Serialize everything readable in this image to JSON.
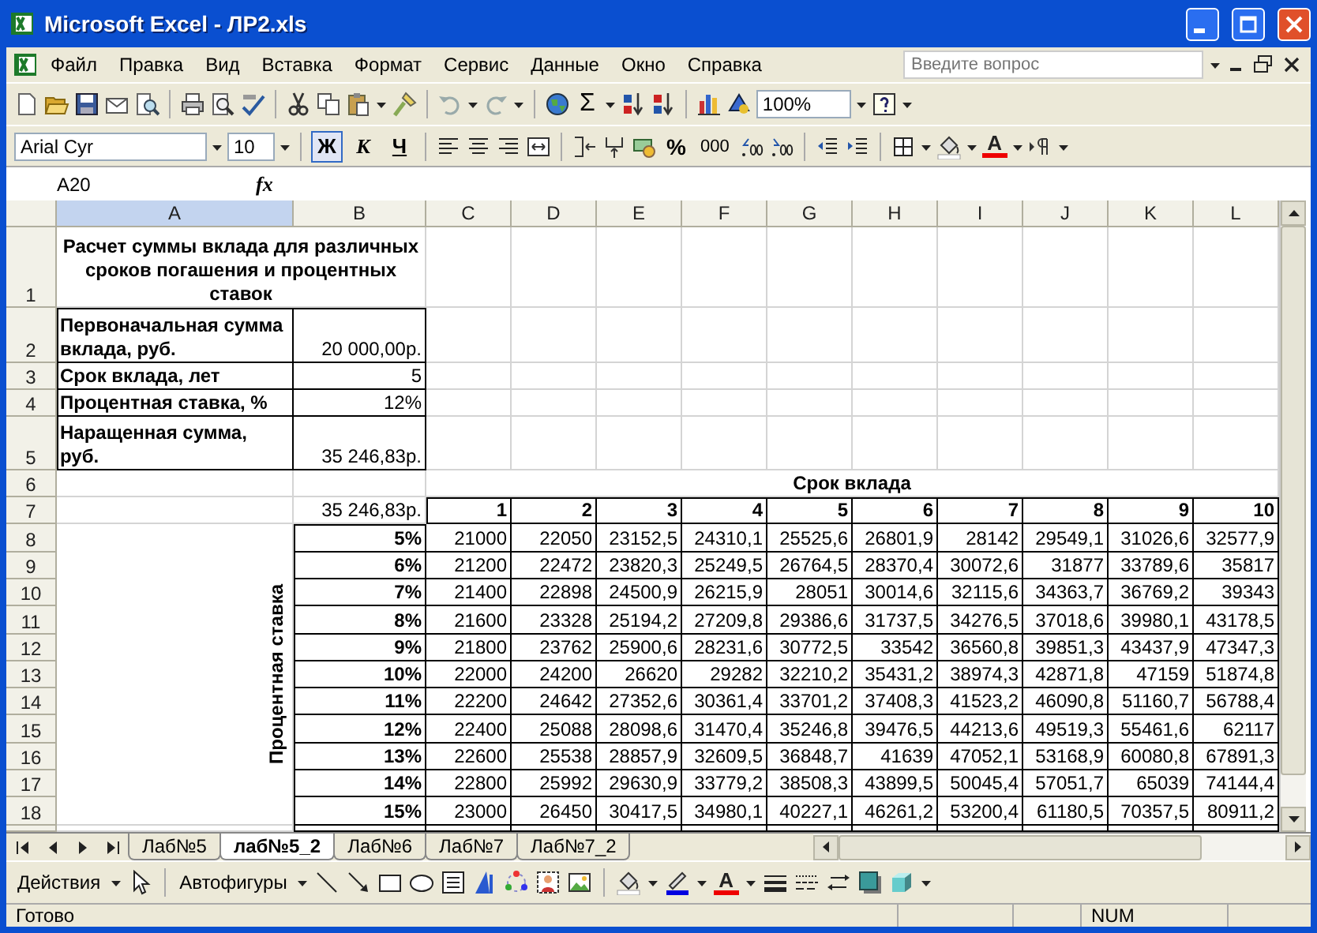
{
  "window": {
    "title": "Microsoft Excel - ЛР2.xls"
  },
  "menu": [
    "Файл",
    "Правка",
    "Вид",
    "Вставка",
    "Формат",
    "Сервис",
    "Данные",
    "Окно",
    "Справка"
  ],
  "help_search": {
    "placeholder": "Введите вопрос"
  },
  "standard_toolbar": {
    "sum": "Σ",
    "zoom": "100%"
  },
  "formatting_toolbar": {
    "font": "Arial Cyr",
    "size": "10",
    "bold": {
      "label": "Ж",
      "pressed": true
    },
    "italic": {
      "label": "К",
      "pressed": false
    },
    "underline": {
      "label": "Ч",
      "pressed": false
    },
    "percent": "%",
    "thousands": "000",
    "font_color": "A"
  },
  "formula_bar": {
    "name_box": "A20",
    "function_label": "fx"
  },
  "sheet": {
    "columns": [
      {
        "label": "A",
        "selected": true
      },
      {
        "label": "B",
        "selected": false
      },
      {
        "label": "C",
        "selected": false
      },
      {
        "label": "D",
        "selected": false
      },
      {
        "label": "E",
        "selected": false
      },
      {
        "label": "F",
        "selected": false
      },
      {
        "label": "G",
        "selected": false
      },
      {
        "label": "H",
        "selected": false
      },
      {
        "label": "I",
        "selected": false
      },
      {
        "label": "J",
        "selected": false
      },
      {
        "label": "K",
        "selected": false
      },
      {
        "label": "L",
        "selected": false
      }
    ],
    "rows": [
      "1",
      "2",
      "3",
      "4",
      "5",
      "6",
      "7",
      "8",
      "9",
      "10",
      "11",
      "12",
      "13",
      "14",
      "15",
      "16",
      "17",
      "18"
    ],
    "title": "Расчет суммы вклада для различных сроков погашения и процентных ставок",
    "params": [
      {
        "label": "Первоначальная сумма вклада, руб.",
        "value": "20 000,00р."
      },
      {
        "label": "Срок вклада, лет",
        "value": "5"
      },
      {
        "label": "Процентная ставка, %",
        "value": "12%"
      },
      {
        "label": "Наращенная сумма, руб.",
        "value": "35 246,83р."
      }
    ],
    "table": {
      "caption": "Срок вклада",
      "corner": "35 246,83р.",
      "axis_label": "Процентная ставка",
      "years": [
        "1",
        "2",
        "3",
        "4",
        "5",
        "6",
        "7",
        "8",
        "9",
        "10"
      ],
      "rows": [
        {
          "rate": "5%",
          "values": [
            "21000",
            "22050",
            "23152,5",
            "24310,1",
            "25525,6",
            "26801,9",
            "28142",
            "29549,1",
            "31026,6",
            "32577,9"
          ]
        },
        {
          "rate": "6%",
          "values": [
            "21200",
            "22472",
            "23820,3",
            "25249,5",
            "26764,5",
            "28370,4",
            "30072,6",
            "31877",
            "33789,6",
            "35817"
          ]
        },
        {
          "rate": "7%",
          "values": [
            "21400",
            "22898",
            "24500,9",
            "26215,9",
            "28051",
            "30014,6",
            "32115,6",
            "34363,7",
            "36769,2",
            "39343"
          ]
        },
        {
          "rate": "8%",
          "values": [
            "21600",
            "23328",
            "25194,2",
            "27209,8",
            "29386,6",
            "31737,5",
            "34276,5",
            "37018,6",
            "39980,1",
            "43178,5"
          ]
        },
        {
          "rate": "9%",
          "values": [
            "21800",
            "23762",
            "25900,6",
            "28231,6",
            "30772,5",
            "33542",
            "36560,8",
            "39851,3",
            "43437,9",
            "47347,3"
          ]
        },
        {
          "rate": "10%",
          "values": [
            "22000",
            "24200",
            "26620",
            "29282",
            "32210,2",
            "35431,2",
            "38974,3",
            "42871,8",
            "47159",
            "51874,8"
          ]
        },
        {
          "rate": "11%",
          "values": [
            "22200",
            "24642",
            "27352,6",
            "30361,4",
            "33701,2",
            "37408,3",
            "41523,2",
            "46090,8",
            "51160,7",
            "56788,4"
          ]
        },
        {
          "rate": "12%",
          "values": [
            "22400",
            "25088",
            "28098,6",
            "31470,4",
            "35246,8",
            "39476,5",
            "44213,6",
            "49519,3",
            "55461,6",
            "62117"
          ]
        },
        {
          "rate": "13%",
          "values": [
            "22600",
            "25538",
            "28857,9",
            "32609,5",
            "36848,7",
            "41639",
            "47052,1",
            "53168,9",
            "60080,8",
            "67891,3"
          ]
        },
        {
          "rate": "14%",
          "values": [
            "22800",
            "25992",
            "29630,9",
            "33779,2",
            "38508,3",
            "43899,5",
            "50045,4",
            "57051,7",
            "65039",
            "74144,4"
          ]
        },
        {
          "rate": "15%",
          "values": [
            "23000",
            "26450",
            "30417,5",
            "34980,1",
            "40227,1",
            "46261,2",
            "53200,4",
            "61180,5",
            "70357,5",
            "80911,2"
          ]
        }
      ]
    }
  },
  "sheet_tabs": [
    {
      "label": "Лаб№5",
      "selected": false
    },
    {
      "label": "лаб№5_2",
      "selected": true
    },
    {
      "label": "Лаб№6",
      "selected": false
    },
    {
      "label": "Лаб№7",
      "selected": false
    },
    {
      "label": "Лаб№7_2",
      "selected": false
    }
  ],
  "drawing_toolbar": {
    "actions": "Действия",
    "autoshapes": "Автофигуры",
    "font_color": "A"
  },
  "status_bar": {
    "status": "Готово",
    "num": "NUM"
  }
}
